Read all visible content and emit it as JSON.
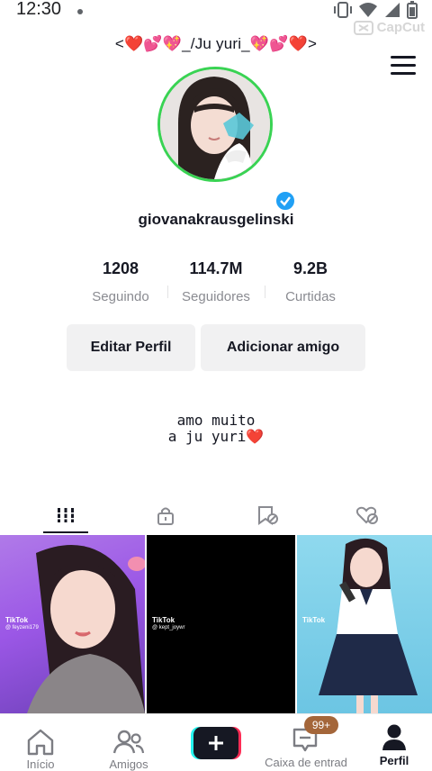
{
  "status_bar": {
    "time": "12:30"
  },
  "watermark": {
    "text": "CapCut"
  },
  "profile": {
    "display_name": "<❤️💕💖_/Ju yuri_💖💕❤️>",
    "username": "giovanakrausgelinski",
    "bio_line1": "amo muito",
    "bio_line2": "a ju yuri❤️"
  },
  "stats": [
    {
      "value": "1208",
      "label": "Seguindo"
    },
    {
      "value": "114.7M",
      "label": "Seguidores"
    },
    {
      "value": "9.2B",
      "label": "Curtidas"
    }
  ],
  "buttons": {
    "edit": "Editar Perfil",
    "add_friend": "Adicionar amigo"
  },
  "videos": [
    {
      "watermark": "TikTok",
      "handle": "@ feyzeni179"
    },
    {
      "watermark": "TikTok",
      "handle": "@ kept_joywr"
    },
    {
      "watermark": "TikTok",
      "handle": ""
    }
  ],
  "bottom_nav": {
    "home": "Início",
    "friends": "Amigos",
    "inbox": "Caixa de entrad",
    "inbox_badge": "99+",
    "profile": "Perfil"
  },
  "colors": {
    "accent_green": "#39d353",
    "verified_blue": "#20a0f5",
    "badge": "#a4663a"
  }
}
